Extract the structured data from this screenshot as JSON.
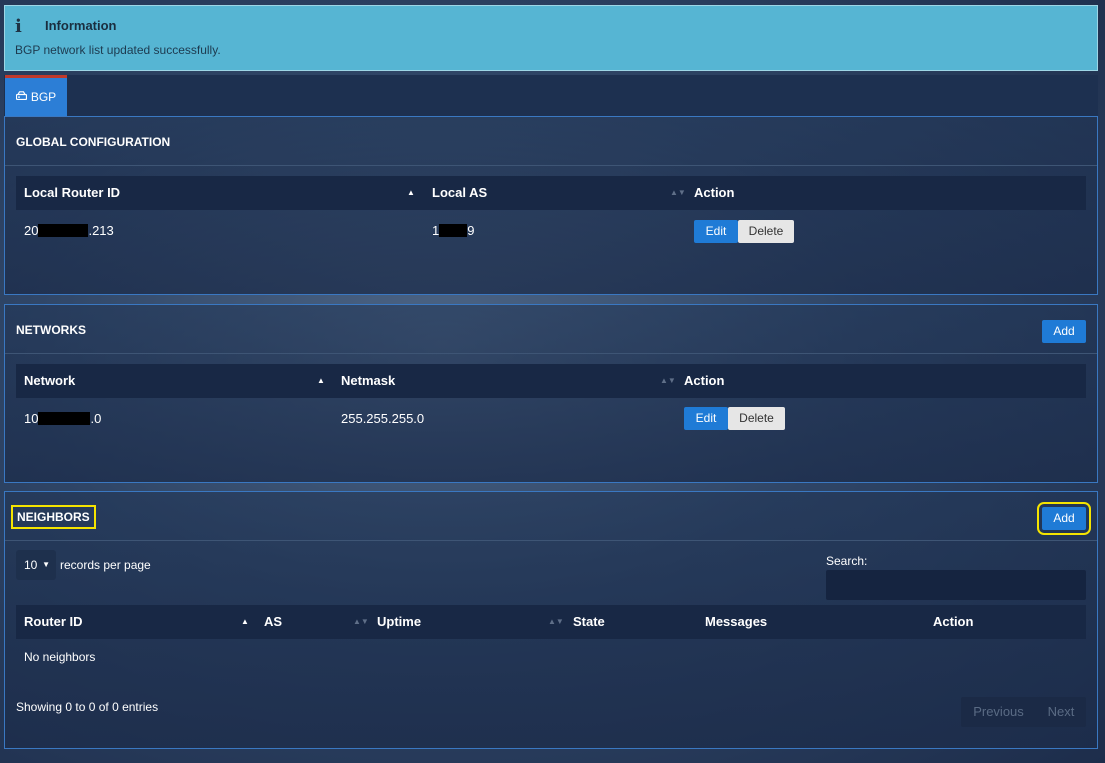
{
  "info": {
    "icon": "info-icon",
    "title": "Information",
    "message": "BGP network list updated successfully."
  },
  "tabs": [
    {
      "label": "BGP",
      "icon": "router-icon",
      "active": true
    }
  ],
  "global": {
    "title": "GLOBAL CONFIGURATION",
    "columns": [
      "Local Router ID",
      "Local AS",
      "Action"
    ],
    "row": {
      "router_id_prefix": "20",
      "router_id_suffix": ".213",
      "as_prefix": "1",
      "as_suffix": "9"
    },
    "edit_label": "Edit",
    "delete_label": "Delete"
  },
  "networks": {
    "title": "NETWORKS",
    "add_label": "Add",
    "columns": [
      "Network",
      "Netmask",
      "Action"
    ],
    "row": {
      "network_prefix": "10",
      "network_suffix": ".0",
      "netmask": "255.255.255.0"
    },
    "edit_label": "Edit",
    "delete_label": "Delete"
  },
  "neighbors": {
    "title": "NEIGHBORS",
    "add_label": "Add",
    "page_size": "10",
    "records_per_page": "records per page",
    "search_label": "Search:",
    "columns": [
      "Router ID",
      "AS",
      "Uptime",
      "State",
      "Messages",
      "Action"
    ],
    "empty": "No neighbors",
    "showing": "Showing 0 to 0 of 0 entries",
    "previous": "Previous",
    "next": "Next"
  },
  "colors": {
    "info_bg": "#56b5d3",
    "accent": "#1f7bd6",
    "tab_top": "#c0392b",
    "highlight": "#f5e400"
  }
}
